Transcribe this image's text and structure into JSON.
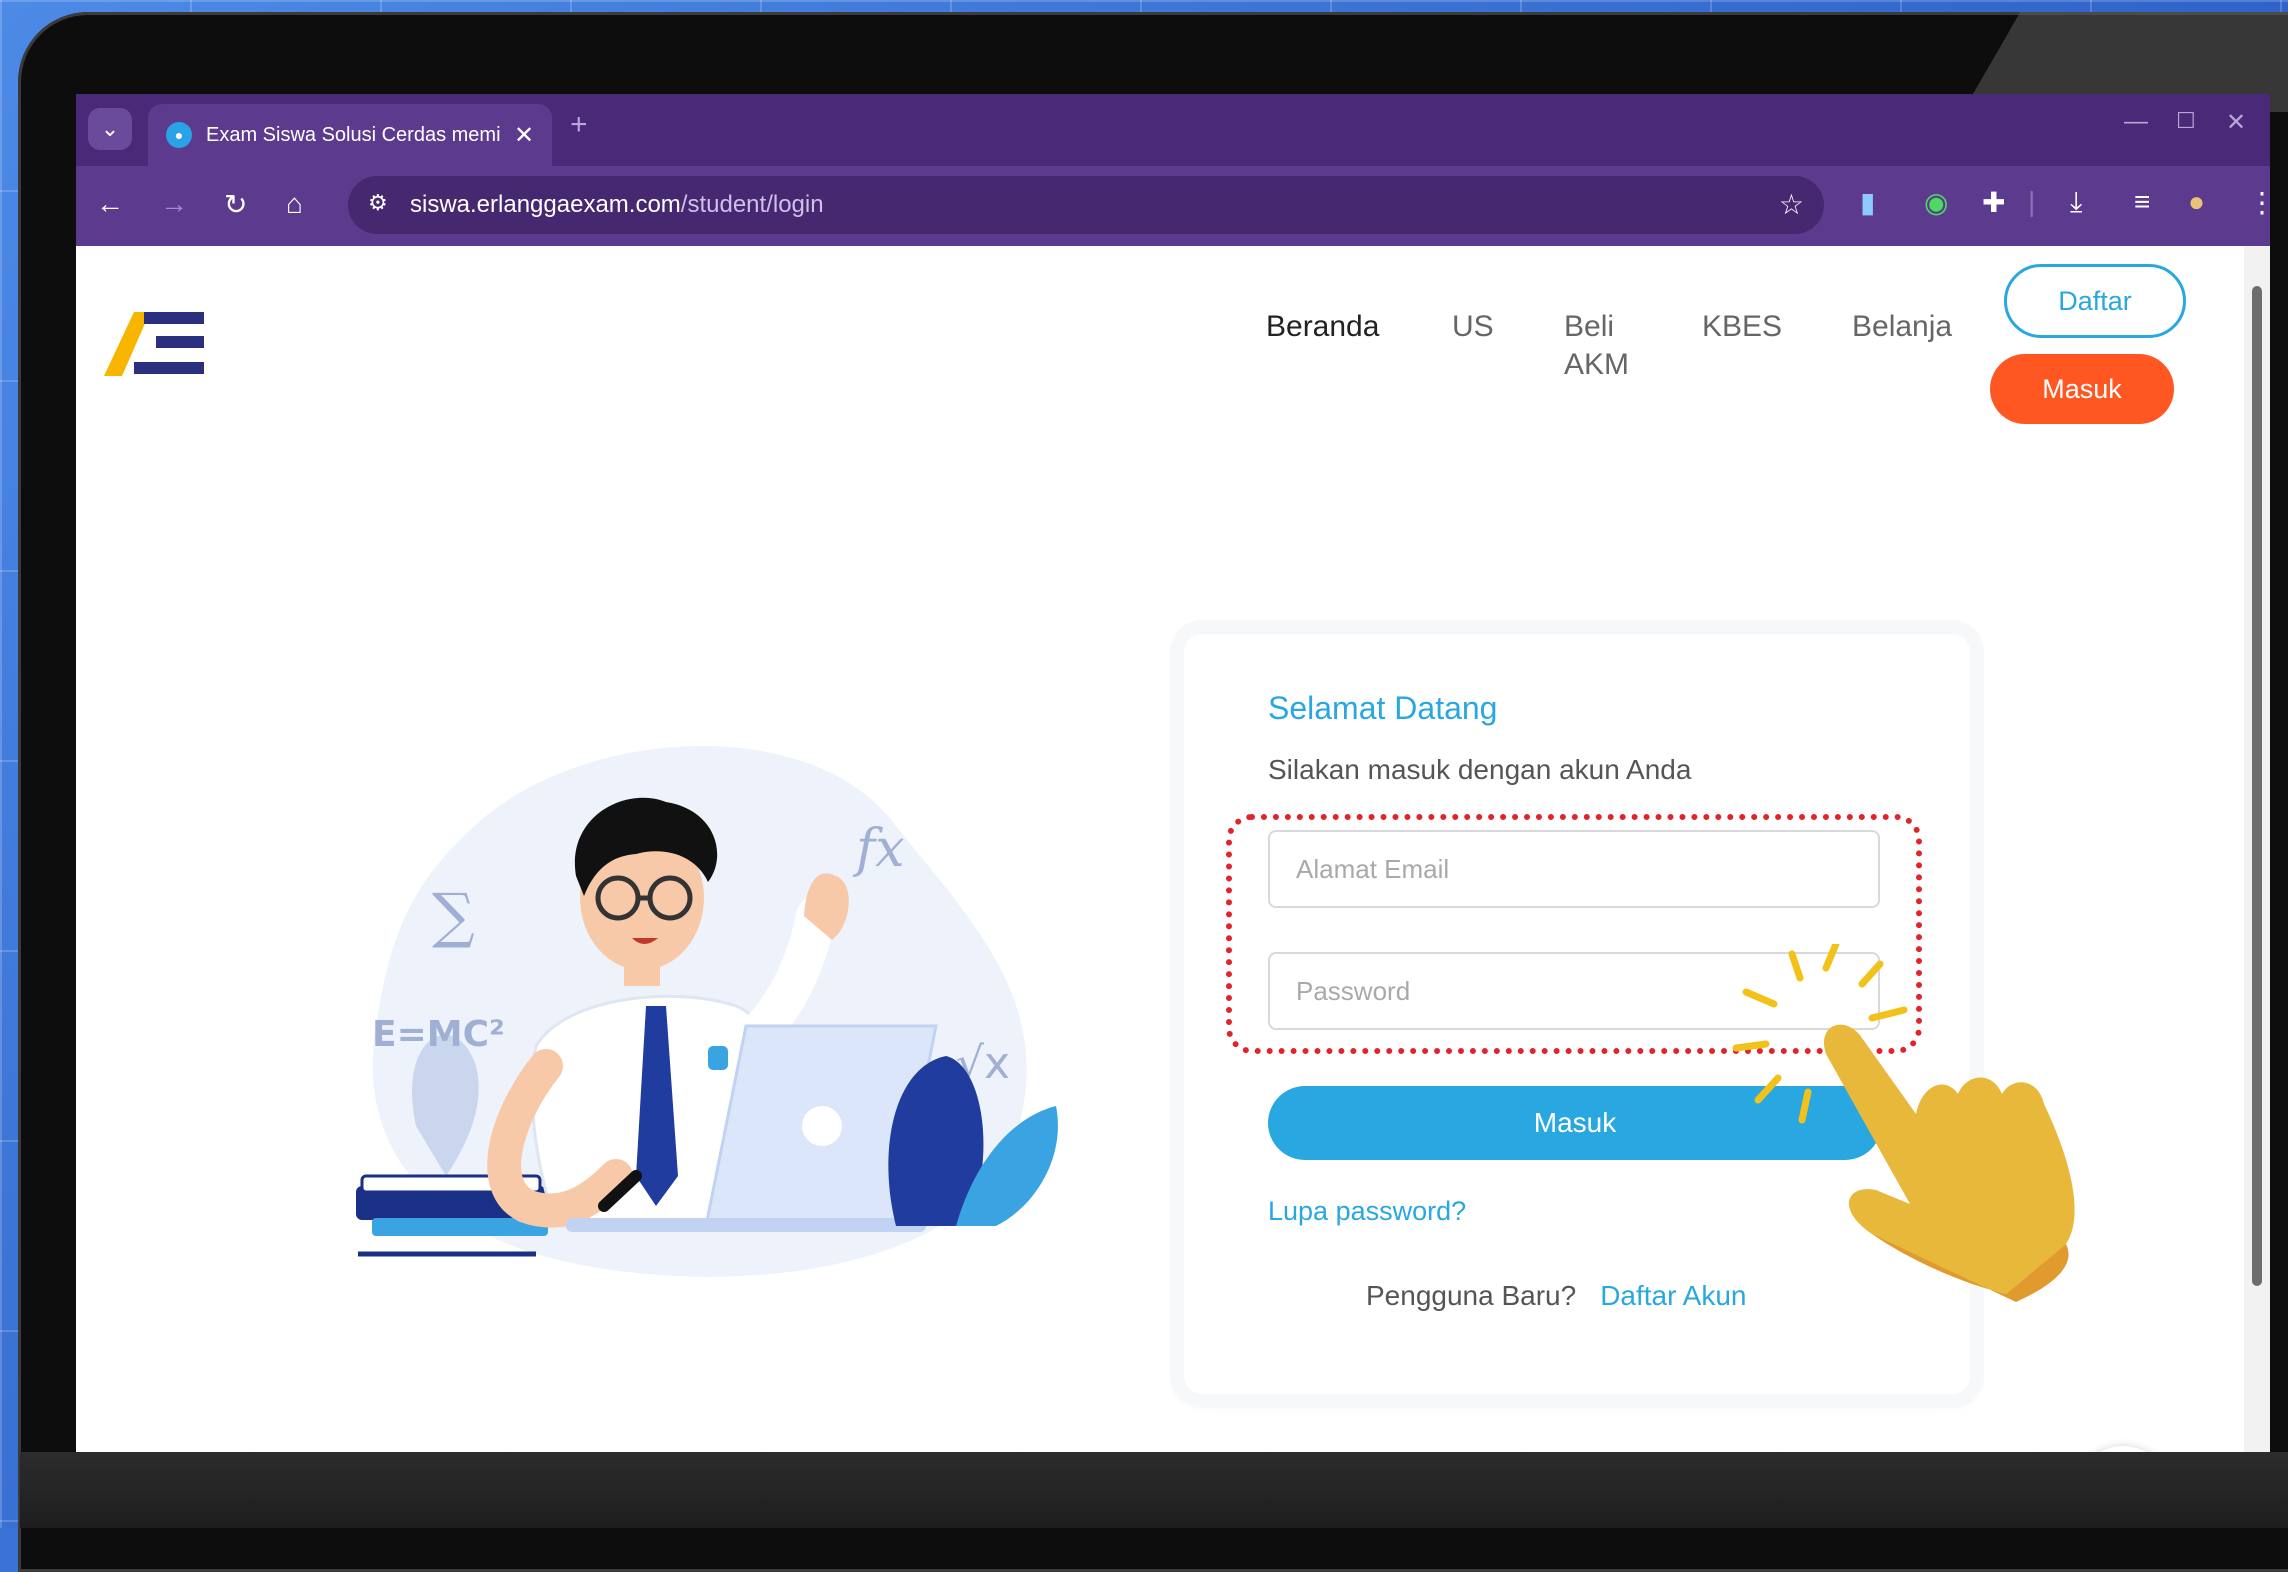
{
  "browser": {
    "tab_title": "Exam Siswa Solusi Cerdas memi",
    "url_host": "siswa.erlanggaexam.com",
    "url_path": "/student/login"
  },
  "nav": {
    "items": [
      {
        "label": "Beranda"
      },
      {
        "label": "US"
      },
      {
        "label": "Beli"
      },
      {
        "label": "AKM"
      },
      {
        "label": "KBES"
      },
      {
        "label": "Belanja"
      }
    ],
    "daftar_label": "Daftar",
    "masuk_label": "Masuk"
  },
  "login": {
    "title": "Selamat Datang",
    "subtitle": "Silakan masuk dengan akun Anda",
    "email_placeholder": "Alamat Email",
    "password_placeholder": "Password",
    "submit_label": "Masuk",
    "forgot_label": "Lupa password?",
    "new_user_label": "Pengguna Baru?",
    "register_label": "Daftar Akun"
  },
  "illustration": {
    "sigma": "∑",
    "formula": "E=MC²",
    "fx": "fx",
    "sqrt": "√x"
  },
  "colors": {
    "accent": "#29a7e1",
    "orange": "#ff5722",
    "browser": "#5c3b8e",
    "highlight": "#e2232a"
  }
}
